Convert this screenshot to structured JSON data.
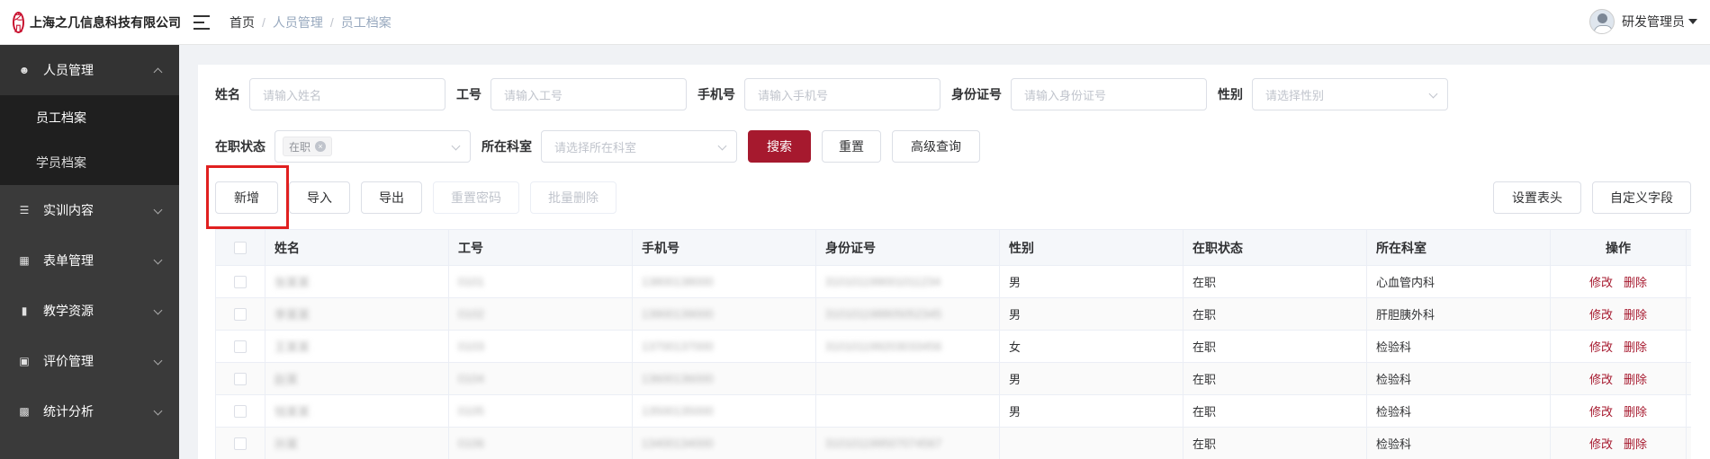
{
  "header": {
    "company": "上海之几信息科技有限公司",
    "logo_mark": "之几",
    "breadcrumb": [
      "首页",
      "人员管理",
      "员工档案"
    ],
    "user_name": "研发管理员"
  },
  "sidebar": {
    "items": [
      {
        "label": "人员管理",
        "icon": "user-icon",
        "open": true,
        "children": [
          "员工档案",
          "学员档案"
        ]
      },
      {
        "label": "实训内容",
        "icon": "training-icon"
      },
      {
        "label": "表单管理",
        "icon": "form-icon"
      },
      {
        "label": "教学资源",
        "icon": "book-icon"
      },
      {
        "label": "评价管理",
        "icon": "evaluation-icon"
      },
      {
        "label": "统计分析",
        "icon": "bar-chart-icon"
      }
    ]
  },
  "filters": {
    "name_label": "姓名",
    "name_placeholder": "请输入姓名",
    "id_label": "工号",
    "id_placeholder": "请输入工号",
    "phone_label": "手机号",
    "phone_placeholder": "请输入手机号",
    "idcard_label": "身份证号",
    "idcard_placeholder": "请输入身份证号",
    "gender_label": "性别",
    "gender_placeholder": "请选择性别",
    "status_label": "在职状态",
    "status_tag": "在职",
    "dept_label": "所在科室",
    "dept_placeholder": "请选择所在科室",
    "search": "搜索",
    "reset": "重置",
    "advanced": "高级查询"
  },
  "toolbar": {
    "add": "新增",
    "import": "导入",
    "export": "导出",
    "reset_password": "重置密码",
    "batch_delete": "批量删除",
    "set_header": "设置表头",
    "custom_field": "自定义字段"
  },
  "table": {
    "columns": [
      "姓名",
      "工号",
      "手机号",
      "身份证号",
      "性别",
      "在职状态",
      "所在科室",
      "操作"
    ],
    "edit": "修改",
    "delete": "删除",
    "rows": [
      {
        "name": "张某某",
        "no": "0101",
        "phone": "13800138000",
        "idcard": "310101199001011234",
        "gender": "男",
        "status": "在职",
        "dept": "心血管内科"
      },
      {
        "name": "李某某",
        "no": "0102",
        "phone": "13900139000",
        "idcard": "310101198805052345",
        "gender": "男",
        "status": "在职",
        "dept": "肝胆胰外科"
      },
      {
        "name": "王某某",
        "no": "0103",
        "phone": "13700137000",
        "idcard": "310101199203033456",
        "gender": "女",
        "status": "在职",
        "dept": "检验科"
      },
      {
        "name": "赵某",
        "no": "0104",
        "phone": "13600136000",
        "idcard": "",
        "gender": "男",
        "status": "在职",
        "dept": "检验科"
      },
      {
        "name": "钱某某",
        "no": "0105",
        "phone": "13500135000",
        "idcard": "",
        "gender": "男",
        "status": "在职",
        "dept": "检验科"
      },
      {
        "name": "孙某",
        "no": "0106",
        "phone": "13400134000",
        "idcard": "310101199507074567",
        "gender": "",
        "status": "在职",
        "dept": "检验科"
      }
    ]
  },
  "colors": {
    "primary": "#a6192e",
    "sidebar_bg": "#3a3a3a",
    "highlight": "#e02020"
  }
}
